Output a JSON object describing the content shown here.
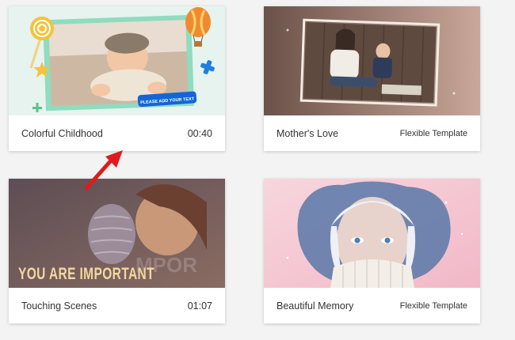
{
  "templates": [
    {
      "title": "Colorful Childhood",
      "meta": "00:40",
      "overlay_text": "PLEASE ADD YOUR TEXT"
    },
    {
      "title": "Mother's Love",
      "meta": "Flexible Template"
    },
    {
      "title": "Touching Scenes",
      "meta": "01:07",
      "overlay_text": "YOU ARE IMPORTANT"
    },
    {
      "title": "Beautiful Memory",
      "meta": "Flexible Template"
    }
  ],
  "annotation": {
    "arrow_color": "#e01b1b",
    "icon": "red-arrow-icon"
  },
  "colors": {
    "card_bg": "#ffffff",
    "page_bg": "#f3f3f3",
    "mint_frame": "#7fd8b8",
    "blue_badge": "#1266d6"
  }
}
